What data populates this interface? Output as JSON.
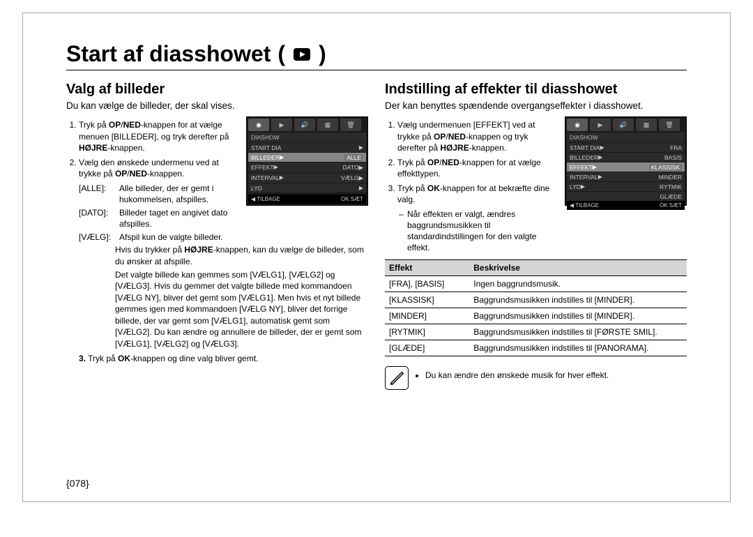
{
  "page_title": "Start af diasshowet",
  "page_number": "{078}",
  "left": {
    "heading": "Valg af billeder",
    "intro": "Du kan vælge de billeder, der skal vises.",
    "step1_a": "Tryk på ",
    "step1_bold1": "OP",
    "step1_slash": "/",
    "step1_bold2": "NED",
    "step1_b": "-knappen for at vælge menuen [BILLEDER], og tryk derefter på ",
    "step1_bold3": "HØJRE",
    "step1_c": "-knappen.",
    "step2_a": "Vælg den ønskede undermenu ved at trykke på ",
    "step2_bold1": "OP",
    "step2_bold2": "NED",
    "step2_b": "-knappen.",
    "def_all_key": "[ALLE]",
    "def_all_val": "Alle billeder, der er gemt i hukommelsen, afspilles.",
    "def_dato_key": "[DATO]",
    "def_dato_val": "Billeder taget en angivet dato afspilles.",
    "def_vaelg_key": "[VÆLG]",
    "def_vaelg_val": "Afspil kun de valgte billeder.",
    "longnote_a": "Hvis du trykker på ",
    "longnote_bold": "HØJRE",
    "longnote_b": "-knappen, kan du vælge de billeder, som du ønsker at afspille.",
    "longnote2": "Det valgte billede kan gemmes som [VÆLG1], [VÆLG2] og [VÆLG3]. Hvis du gemmer det valgte billede med kommandoen [VÆLG NY], bliver det gemt som [VÆLG1]. Men hvis et nyt billede gemmes igen med kommandoen [VÆLG NY], bliver det forrige billede, der var gemt som [VÆLG1], automatisk gemt som [VÆLG2]. Du kan ændre og annullere de billeder, der er gemt som [VÆLG1], [VÆLG2] og [VÆLG3].",
    "step3_a": "Tryk på ",
    "step3_bold": "OK",
    "step3_b": "-knappen og dine valg bliver gemt.",
    "lcd": {
      "title": "DIASHOW",
      "rows": [
        {
          "l": "START DIA",
          "r": ""
        },
        {
          "l": "BILLEDER",
          "r": "ALLE",
          "sel": true
        },
        {
          "l": "EFFEKT",
          "r": "DATO▶"
        },
        {
          "l": "INTERVAL",
          "r": "VÆLG▶"
        },
        {
          "l": "LYD",
          "r": ""
        }
      ],
      "foot_l": "◀  TILBAGE",
      "foot_r": "OK  SÆT"
    }
  },
  "right": {
    "heading": "Indstilling af effekter til diasshowet",
    "intro": "Der kan benyttes spændende overgangseffekter i diasshowet.",
    "step1_a": "Vælg undermenuen [EFFEKT] ved at trykke på ",
    "step1_bold1": "OP",
    "step1_bold2": "NED",
    "step1_b": "-knappen og tryk derefter på ",
    "step1_bold3": "HØJRE",
    "step1_c": "-knappen.",
    "step2_a": "Tryk på ",
    "step2_bold1": "OP",
    "step2_bold2": "NED",
    "step2_b": "-knappen for at vælge effekttypen.",
    "step3_a": "Tryk på ",
    "step3_bold": "OK",
    "step3_b": "-knappen for at bekræfte dine valg.",
    "subnote": "Når effekten er valgt, ændres baggrundsmusikken til standardindstillingen for den valgte effekt.",
    "lcd": {
      "title": "DIASHOW",
      "rows": [
        {
          "l": "START DIA",
          "r": "FRA"
        },
        {
          "l": "BILLEDER",
          "r": "BASIS"
        },
        {
          "l": "EFFEKT",
          "r": "KLASSISK",
          "sel": true
        },
        {
          "l": "INTERVAL",
          "r": "MINDER"
        },
        {
          "l": "LYD",
          "r": "RYTMIK"
        },
        {
          "l": "",
          "r": "GLÆDE"
        }
      ],
      "foot_l": "◀  TILBAGE",
      "foot_r": "OK  SÆT"
    },
    "table": {
      "head_effect": "Effekt",
      "head_desc": "Beskrivelse",
      "rows": [
        {
          "e": "[FRA], [BASIS]",
          "d": "Ingen baggrundsmusik."
        },
        {
          "e": "[KLASSISK]",
          "d": "Baggrundsmusikken indstilles til [MINDER]."
        },
        {
          "e": "[MINDER]",
          "d": "Baggrundsmusikken indstilles til [MINDER]."
        },
        {
          "e": "[RYTMIK]",
          "d": "Baggrundsmusikken indstilles til [FØRSTE SMIL]."
        },
        {
          "e": "[GLÆDE]",
          "d": "Baggrundsmusikken indstilles til [PANORAMA]."
        }
      ]
    },
    "note_bullet": "Du kan ændre den ønskede musik for hver effekt."
  }
}
